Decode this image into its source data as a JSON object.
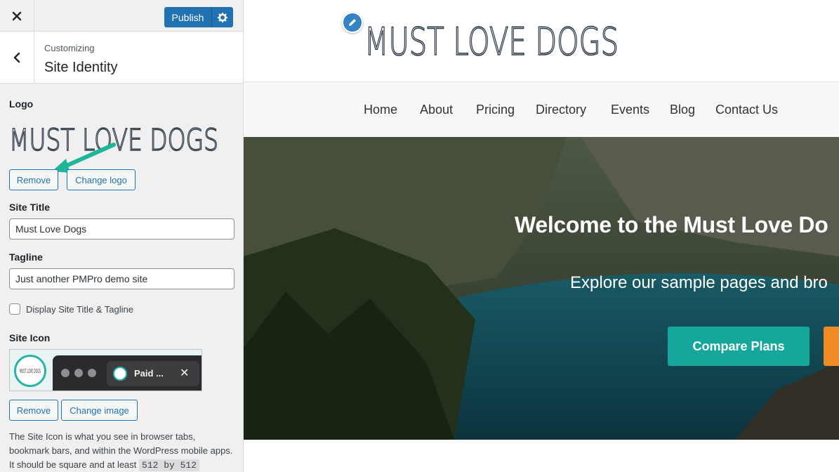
{
  "sidebar": {
    "close_icon": "close-icon",
    "publish_label": "Publish",
    "publish_settings_icon": "gear-icon",
    "back_icon": "chevron-left-icon",
    "customizing_label": "Customizing",
    "section_title": "Site Identity",
    "logo": {
      "label": "Logo",
      "image_text": "MUST LOVE DOGS",
      "remove_label": "Remove",
      "change_label": "Change logo"
    },
    "site_title": {
      "label": "Site Title",
      "value": "Must Love Dogs"
    },
    "tagline": {
      "label": "Tagline",
      "value": "Just another PMPro demo site"
    },
    "display_title_tagline": {
      "label": "Display Site Title & Tagline",
      "checked": false
    },
    "site_icon": {
      "label": "Site Icon",
      "icon_text": "MUST LOVE DOGS",
      "tab_title": "Paid ...",
      "tab_close": "✕",
      "remove_label": "Remove",
      "change_label": "Change image",
      "description_pre": "The Site Icon is what you see in browser tabs, bookmark bars, and within the WordPress mobile apps. It should be square and at least ",
      "description_code": "512 by 512"
    }
  },
  "preview": {
    "edit_icon": "pencil-icon",
    "logo_text": "MUST LOVE DOGS",
    "nav": [
      "Home",
      "About",
      "Pricing",
      "Directory",
      "Events",
      "Blog",
      "Contact Us"
    ],
    "hero": {
      "title": "Welcome to the Must Love Do",
      "subtitle": "Explore our sample pages and bro",
      "primary_cta": "Compare Plans"
    }
  },
  "colors": {
    "wp_blue": "#2271b1",
    "teal": "#15a79b",
    "orange": "#f08a24",
    "annotation_arrow": "#1fb59a"
  }
}
